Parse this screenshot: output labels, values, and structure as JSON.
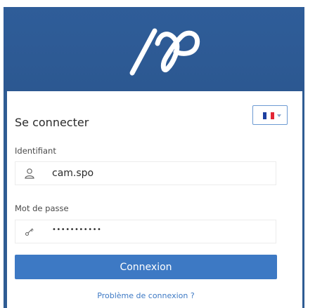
{
  "login": {
    "title": "Se connecter",
    "language": {
      "selected": "Français",
      "flag_colors": [
        "#1d3fa0",
        "#ffffff",
        "#e32636"
      ]
    },
    "username": {
      "label": "Identifiant",
      "value": "cam.spo",
      "icon": "user-icon"
    },
    "password": {
      "label": "Mot de passe",
      "masked_value": "•••••••••••",
      "icon": "key-icon"
    },
    "submit_label": "Connexion",
    "help_link": "Problème de connexion ?"
  },
  "colors": {
    "header_bg": "#2f5d99",
    "accent": "#3d79c4"
  }
}
